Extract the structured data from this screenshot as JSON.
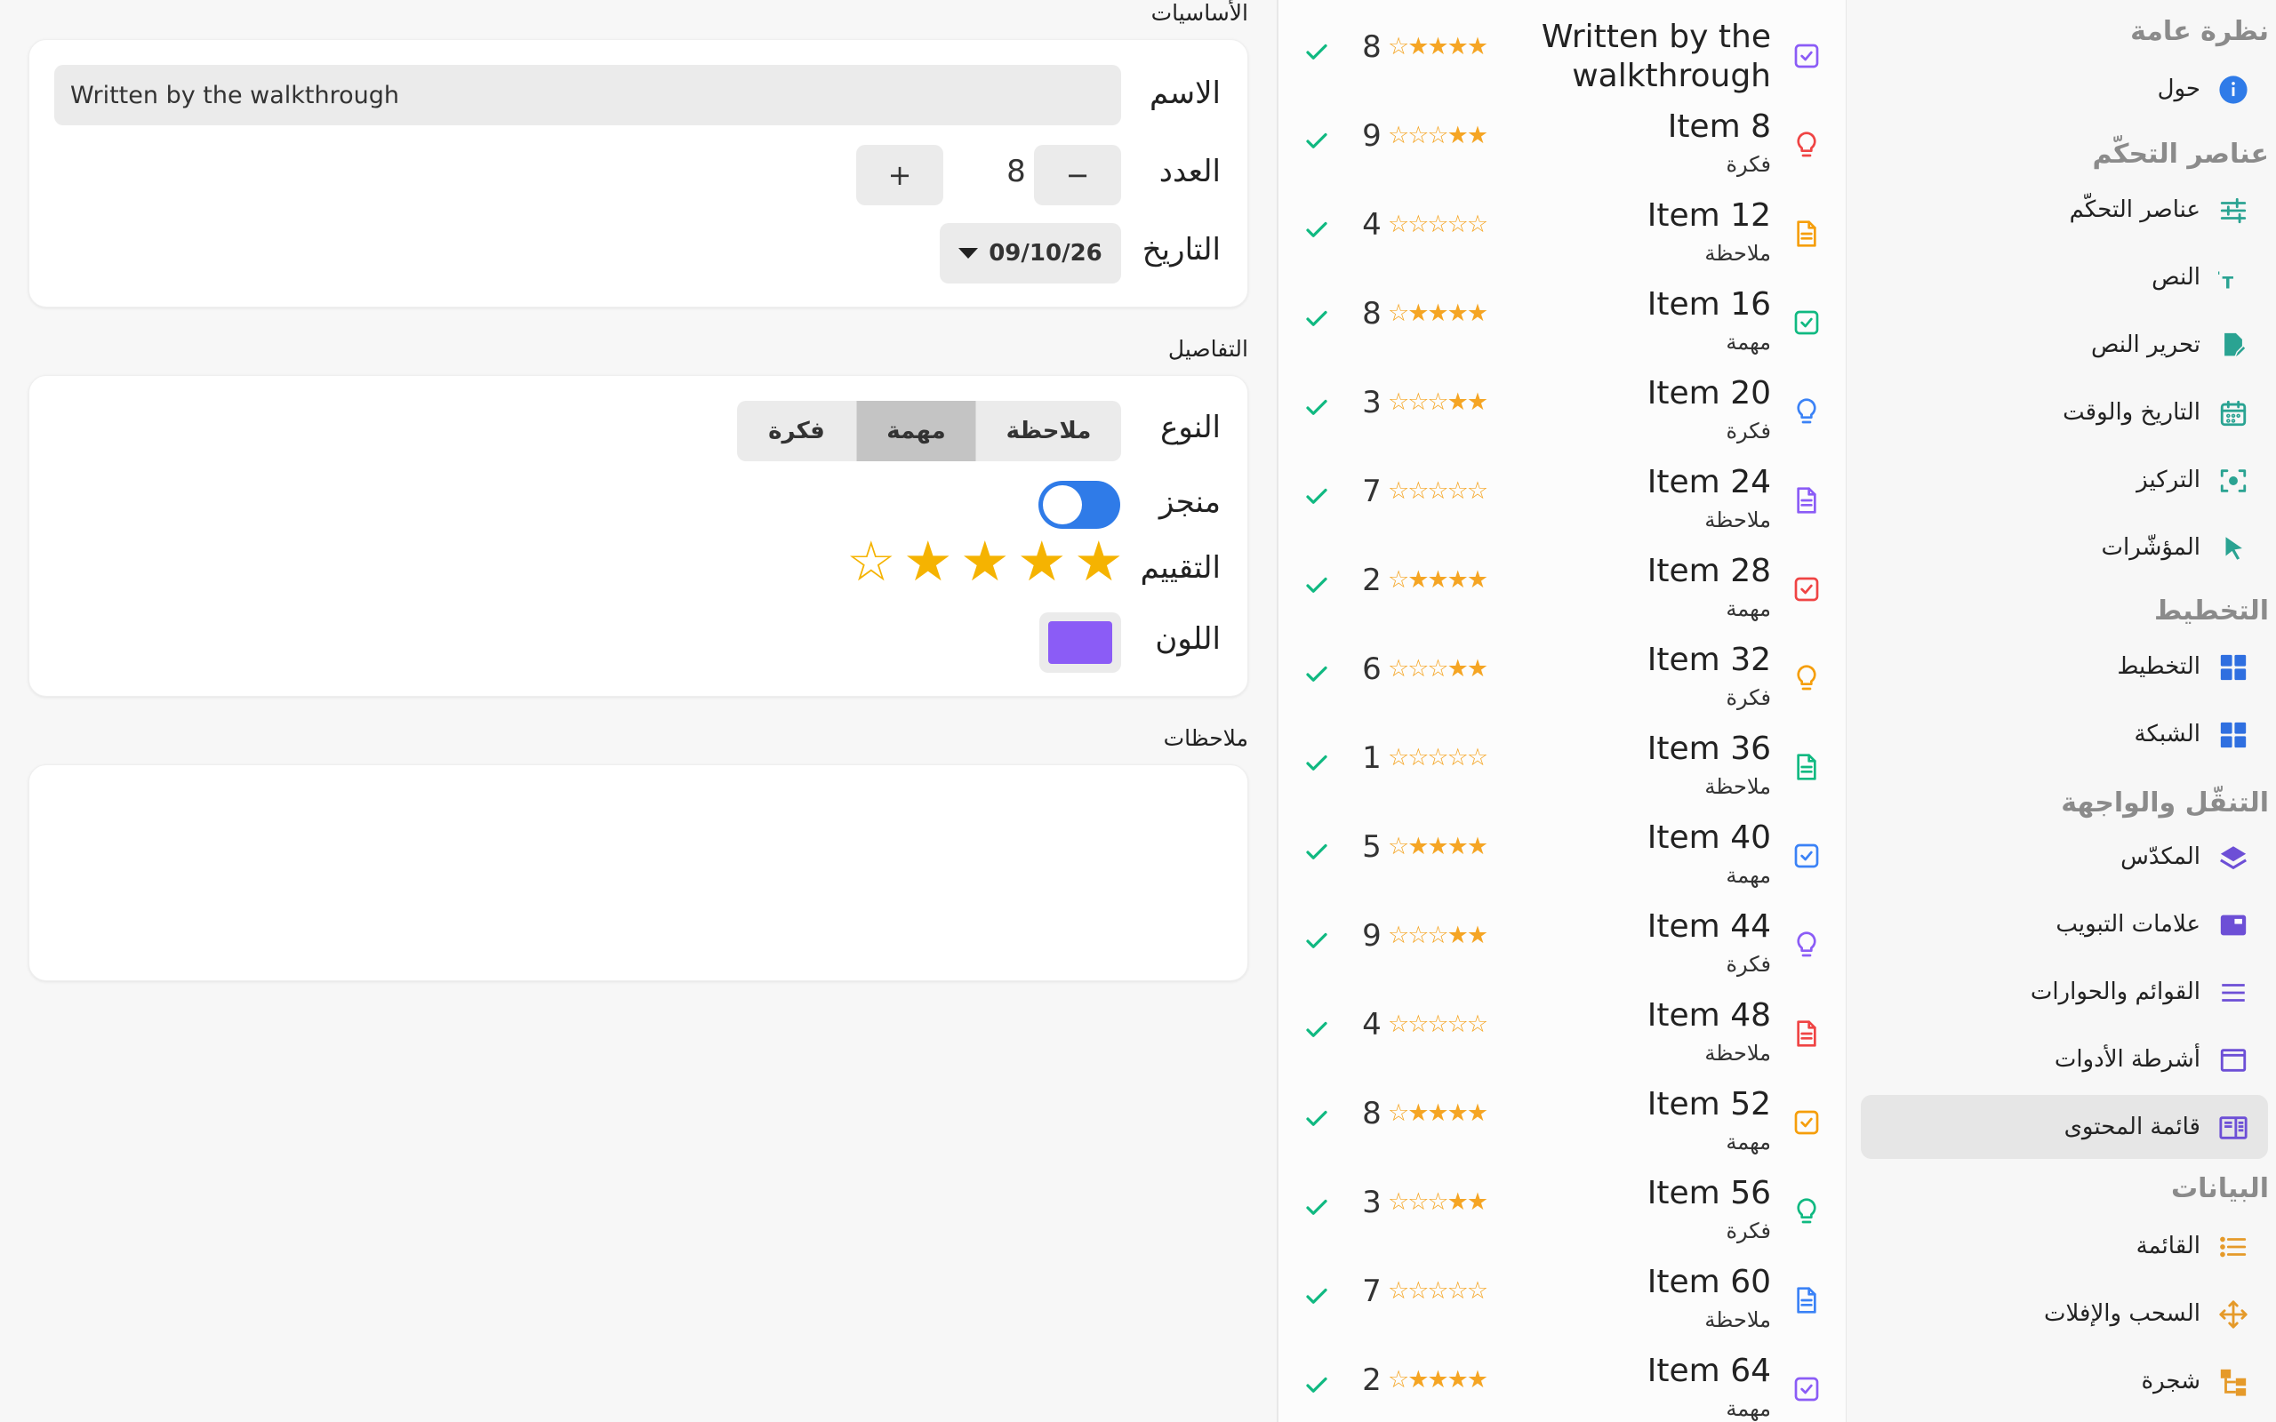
{
  "sidebar": {
    "sections": [
      {
        "title": "نظرة عامة",
        "items": [
          {
            "label": "حول",
            "icon": "info-icon"
          }
        ]
      },
      {
        "title": "عناصر التحكّم",
        "items": [
          {
            "label": "عناصر التحكّم",
            "icon": "sliders-icon"
          },
          {
            "label": "النص",
            "icon": "text-icon"
          },
          {
            "label": "تحرير النص",
            "icon": "edit-document-icon"
          },
          {
            "label": "التاريخ والوقت",
            "icon": "calendar-icon"
          },
          {
            "label": "التركيز",
            "icon": "focus-icon"
          },
          {
            "label": "المؤشّرات",
            "icon": "pointer-icon"
          }
        ]
      },
      {
        "title": "التخطيط",
        "items": [
          {
            "label": "التخطيط",
            "icon": "layout-icon"
          },
          {
            "label": "الشبكة",
            "icon": "grid-icon"
          }
        ]
      },
      {
        "title": "التنقّل والواجهة",
        "items": [
          {
            "label": "المكدّس",
            "icon": "stack-icon"
          },
          {
            "label": "علامات التبويب",
            "icon": "tabs-icon"
          },
          {
            "label": "القوائم والحوارات",
            "icon": "menu-icon"
          },
          {
            "label": "أشرطة الأدوات",
            "icon": "toolbar-icon"
          },
          {
            "label": "قائمة المحتوى",
            "icon": "sidebar-icon",
            "active": true
          }
        ]
      },
      {
        "title": "البيانات",
        "items": [
          {
            "label": "القائمة",
            "icon": "list-icon"
          },
          {
            "label": "السحب والإفلات",
            "icon": "drag-icon"
          },
          {
            "label": "شجرة",
            "icon": "tree-icon"
          }
        ]
      }
    ]
  },
  "list": {
    "rows": [
      {
        "title": "Written by the walkthrough",
        "subtitle": "",
        "type": "task",
        "color": "#8b5cf6",
        "rating": 4,
        "count": "8"
      },
      {
        "title": "Item 8",
        "subtitle": "فكرة",
        "type": "idea",
        "color": "#ef4444",
        "rating": 2,
        "count": "9"
      },
      {
        "title": "Item 12",
        "subtitle": "ملاحظة",
        "type": "note",
        "color": "#f59e0b",
        "rating": 0,
        "count": "4"
      },
      {
        "title": "Item 16",
        "subtitle": "مهمة",
        "type": "task",
        "color": "#10b981",
        "rating": 4,
        "count": "8"
      },
      {
        "title": "Item 20",
        "subtitle": "فكرة",
        "type": "idea",
        "color": "#3b82f6",
        "rating": 2,
        "count": "3"
      },
      {
        "title": "Item 24",
        "subtitle": "ملاحظة",
        "type": "note",
        "color": "#8b5cf6",
        "rating": 0,
        "count": "7"
      },
      {
        "title": "Item 28",
        "subtitle": "مهمة",
        "type": "task",
        "color": "#ef4444",
        "rating": 4,
        "count": "2"
      },
      {
        "title": "Item 32",
        "subtitle": "فكرة",
        "type": "idea",
        "color": "#f59e0b",
        "rating": 2,
        "count": "6"
      },
      {
        "title": "Item 36",
        "subtitle": "ملاحظة",
        "type": "note",
        "color": "#10b981",
        "rating": 0,
        "count": "1"
      },
      {
        "title": "Item 40",
        "subtitle": "مهمة",
        "type": "task",
        "color": "#3b82f6",
        "rating": 4,
        "count": "5"
      },
      {
        "title": "Item 44",
        "subtitle": "فكرة",
        "type": "idea",
        "color": "#8b5cf6",
        "rating": 2,
        "count": "9"
      },
      {
        "title": "Item 48",
        "subtitle": "ملاحظة",
        "type": "note",
        "color": "#ef4444",
        "rating": 0,
        "count": "4"
      },
      {
        "title": "Item 52",
        "subtitle": "مهمة",
        "type": "task",
        "color": "#f59e0b",
        "rating": 4,
        "count": "8"
      },
      {
        "title": "Item 56",
        "subtitle": "فكرة",
        "type": "idea",
        "color": "#10b981",
        "rating": 2,
        "count": "3"
      },
      {
        "title": "Item 60",
        "subtitle": "ملاحظة",
        "type": "note",
        "color": "#3b82f6",
        "rating": 0,
        "count": "7"
      },
      {
        "title": "Item 64",
        "subtitle": "مهمة",
        "type": "task",
        "color": "#8b5cf6",
        "rating": 4,
        "count": "2"
      }
    ]
  },
  "form": {
    "basics": {
      "title": "الأساسيات",
      "name_label": "الاسم",
      "name_value": "Written by the walkthrough",
      "count_label": "العدد",
      "count_value": "8",
      "minus": "−",
      "plus": "+",
      "date_label": "التاريخ",
      "date_value": "09/10/26"
    },
    "details": {
      "title": "التفاصيل",
      "type_label": "النوع",
      "type_options": [
        "ملاحظة",
        "مهمة",
        "فكرة"
      ],
      "type_selected": "مهمة",
      "done_label": "منجز",
      "done": true,
      "rating_label": "التقييم",
      "rating": 4,
      "rating_max": 5,
      "color_label": "اللون",
      "color_value": "#8b5cf6"
    },
    "notes": {
      "title": "ملاحظات",
      "value": ""
    }
  },
  "colors": {
    "accent": "#2f7be8",
    "check": "#10b981",
    "star": "#f5b301"
  }
}
